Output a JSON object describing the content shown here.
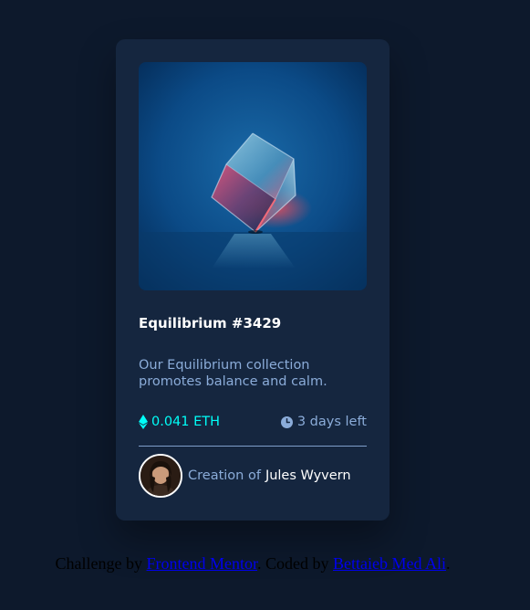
{
  "card": {
    "image_alt": "Equilibrium crystal cube",
    "title": "Equilibrium #3429",
    "description": "Our Equilibrium collection promotes balance and calm.",
    "price": "0.041 ETH",
    "time_left": "3 days left",
    "creator_prefix": "Creation of",
    "creator_name": "Jules Wyvern"
  },
  "attribution": {
    "prefix": "Challenge by ",
    "link1": "Frontend Mentor",
    "middle": ". Coded by ",
    "link2": "Bettaieb Med Ali",
    "suffix": "."
  },
  "colors": {
    "page_bg": "#0d192c",
    "card_bg": "#15263f",
    "accent_cyan": "#00fff8",
    "soft_blue": "#8bacd9",
    "white": "#ffffff"
  },
  "icons": [
    "ethereum-icon",
    "clock-icon"
  ]
}
